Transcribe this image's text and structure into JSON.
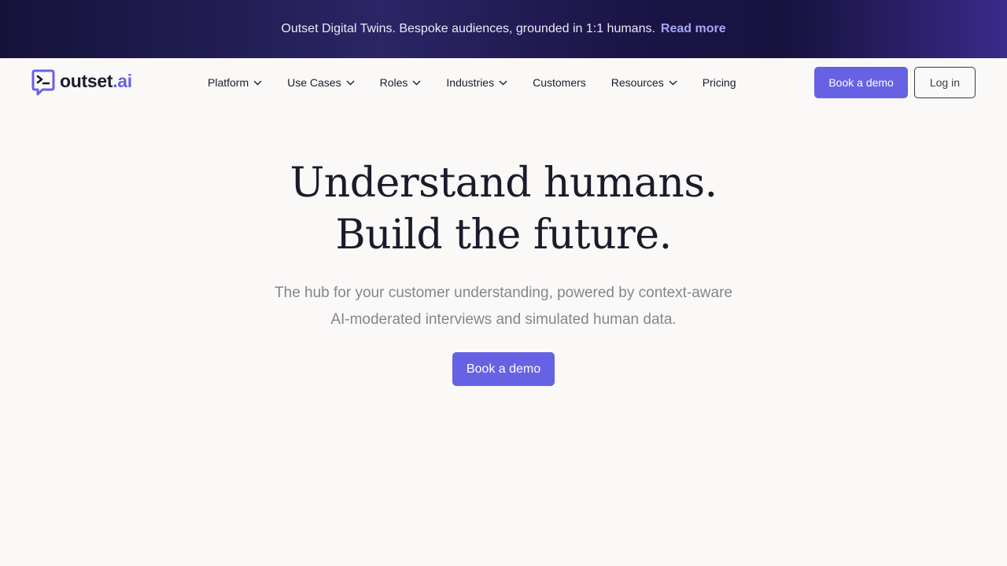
{
  "banner": {
    "text": "Outset Digital Twins. Bespoke audiences, grounded in 1:1 humans.",
    "link_label": "Read more"
  },
  "logo": {
    "word": "outset",
    "suffix": ".ai",
    "icon": "chat-terminal-icon"
  },
  "nav": {
    "items": [
      {
        "label": "Platform",
        "has_dropdown": true
      },
      {
        "label": "Use Cases",
        "has_dropdown": true
      },
      {
        "label": "Roles",
        "has_dropdown": true
      },
      {
        "label": "Industries",
        "has_dropdown": true
      },
      {
        "label": "Customers",
        "has_dropdown": false
      },
      {
        "label": "Resources",
        "has_dropdown": true
      },
      {
        "label": "Pricing",
        "has_dropdown": false
      }
    ],
    "demo_label": "Book a demo",
    "login_label": "Log in"
  },
  "hero": {
    "title_line1": "Understand humans.",
    "title_line2": "Build the future.",
    "subtitle": "The hub for your customer understanding, powered by context-aware AI-moderated interviews and simulated human data.",
    "cta_label": "Book a demo"
  },
  "colors": {
    "accent": "#6762e3",
    "banner_link": "#a9a6f5",
    "text": "#1c1b2b",
    "muted": "#86848f",
    "background": "#faf9f7"
  }
}
